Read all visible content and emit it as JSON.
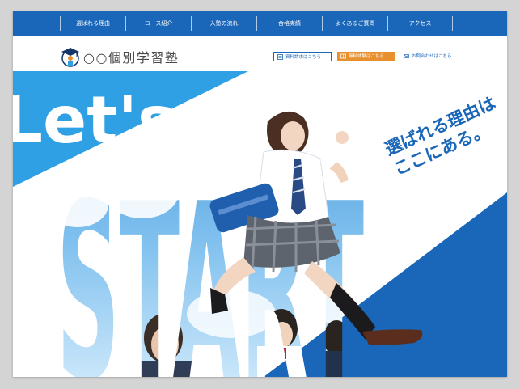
{
  "nav": {
    "items": [
      "選ばれる理由",
      "コース紹介",
      "入塾の流れ",
      "合格実績",
      "よくあるご質問",
      "アクセス"
    ]
  },
  "brand": {
    "name": "○○個別学習塾"
  },
  "header_buttons": {
    "request": "資料請求はこちら",
    "trial": "無料体験はこちら",
    "contact": "お問合わせはこちら"
  },
  "hero": {
    "lets_text": "Let's",
    "start_text": "START",
    "catch_line1": "選ばれる理由は",
    "catch_line2": "ここにある。"
  },
  "colors": {
    "brand_blue": "#1a66b8",
    "light_blue": "#2fa0e4",
    "orange": "#e8902e",
    "navy": "#14376b"
  },
  "icons": [
    "graduation-cap-logo-icon",
    "document-icon",
    "book-icon",
    "mail-icon"
  ]
}
